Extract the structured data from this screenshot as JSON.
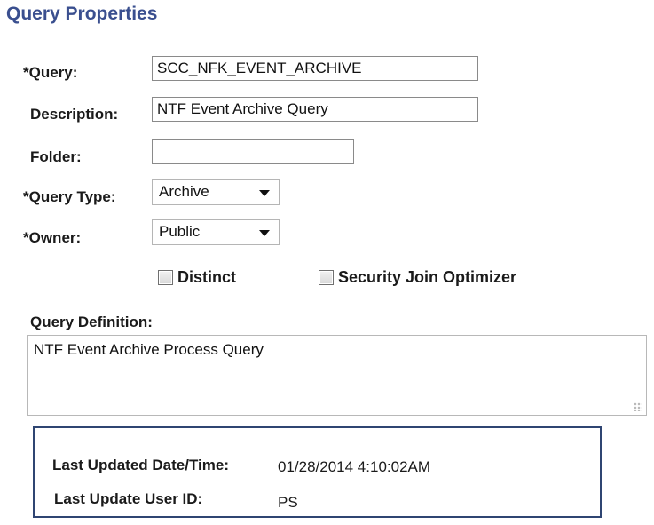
{
  "page": {
    "title": "Query Properties"
  },
  "form": {
    "query": {
      "label": "*Query:",
      "value": "SCC_NFK_EVENT_ARCHIVE"
    },
    "description": {
      "label": "Description:",
      "value": "NTF Event Archive Query"
    },
    "folder": {
      "label": "Folder:",
      "value": ""
    },
    "query_type": {
      "label": "*Query Type:",
      "value": "Archive"
    },
    "owner": {
      "label": "*Owner:",
      "value": "Public"
    },
    "distinct": {
      "label": "Distinct",
      "checked": false
    },
    "security_join_optimizer": {
      "label": "Security Join Optimizer",
      "checked": false
    },
    "query_definition": {
      "label": "Query Definition:",
      "value": "NTF Event Archive Process Query"
    }
  },
  "info": {
    "last_updated_label": "Last Updated Date/Time:",
    "last_updated_value": "01/28/2014  4:10:02AM",
    "last_user_label": "Last Update User ID:",
    "last_user_value": "PS"
  },
  "colors": {
    "title": "#3a4f8f",
    "info_border": "#2f4572"
  }
}
